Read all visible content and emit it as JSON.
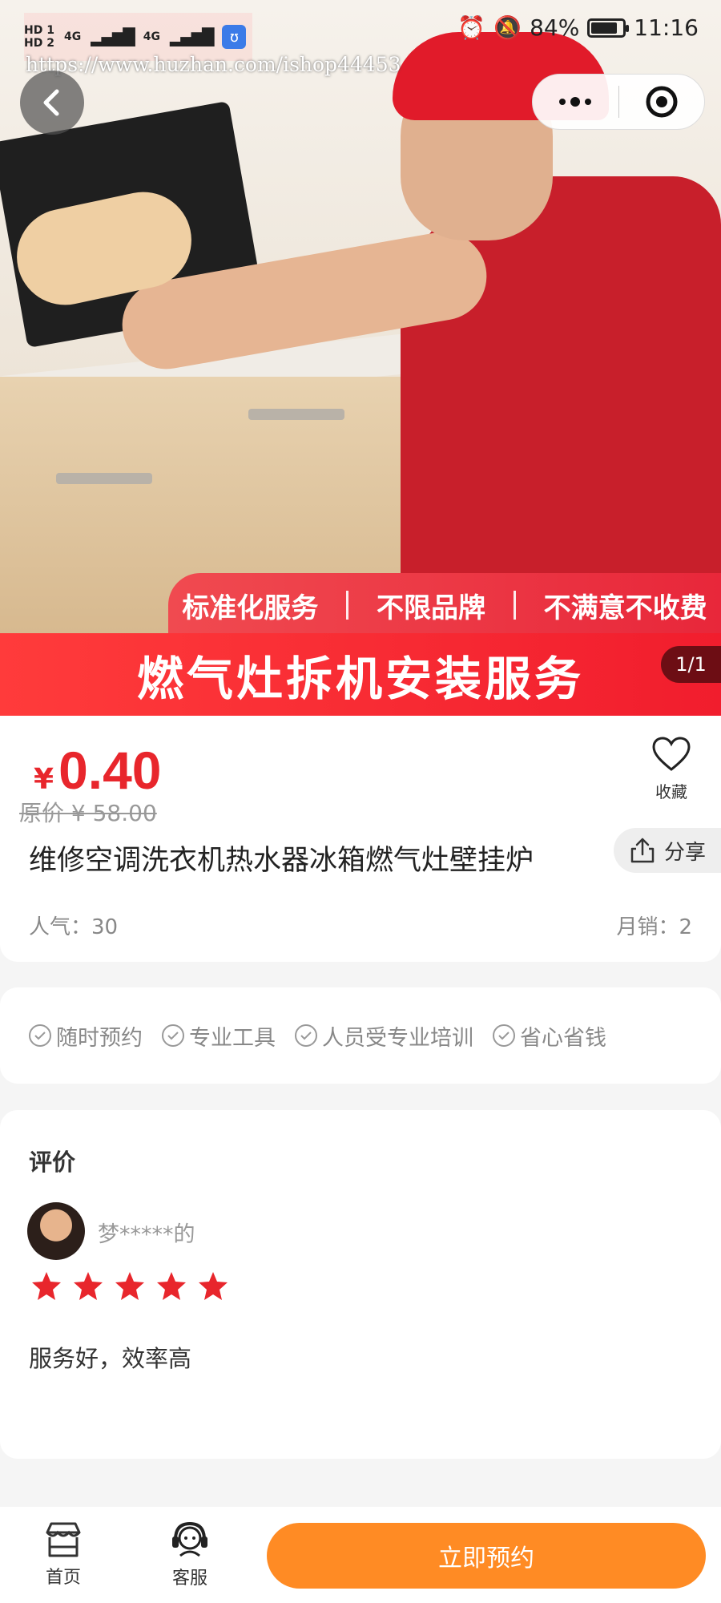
{
  "status_bar": {
    "hd1": "HD 1",
    "hd2": "HD 2",
    "sig1": "4G",
    "sig2": "4G",
    "battery_pct": "84%",
    "battery_level": 0.84,
    "time": "11:16"
  },
  "watermark": "https://www.huzhan.com/ishop44453",
  "hero": {
    "badges": [
      "标准化服务",
      "不限品牌",
      "不满意不收费"
    ],
    "headline": "燃气灶拆机安装服务",
    "pager": "1/1"
  },
  "product": {
    "currency": "¥",
    "price": "0.40",
    "original_price": "原价 ¥ 58.00",
    "favorite_label": "收藏",
    "title": "维修空调洗衣机热水器冰箱燃气灶壁挂炉",
    "share_label": "分享",
    "popularity": "人气：30",
    "monthly_sales": "月销：2"
  },
  "features": [
    "随时预约",
    "专业工具",
    "人员受专业培训",
    "省心省钱"
  ],
  "reviews": {
    "heading": "评价",
    "items": [
      {
        "user": "梦*****的",
        "rating": 5,
        "text": "服务好，效率高"
      }
    ]
  },
  "bottom_bar": {
    "home_label": "首页",
    "service_label": "客服",
    "book_label": "立即预约"
  },
  "colors": {
    "price_red": "#e8262c",
    "book_orange": "#ff8b24",
    "star_red": "#e8262c"
  }
}
